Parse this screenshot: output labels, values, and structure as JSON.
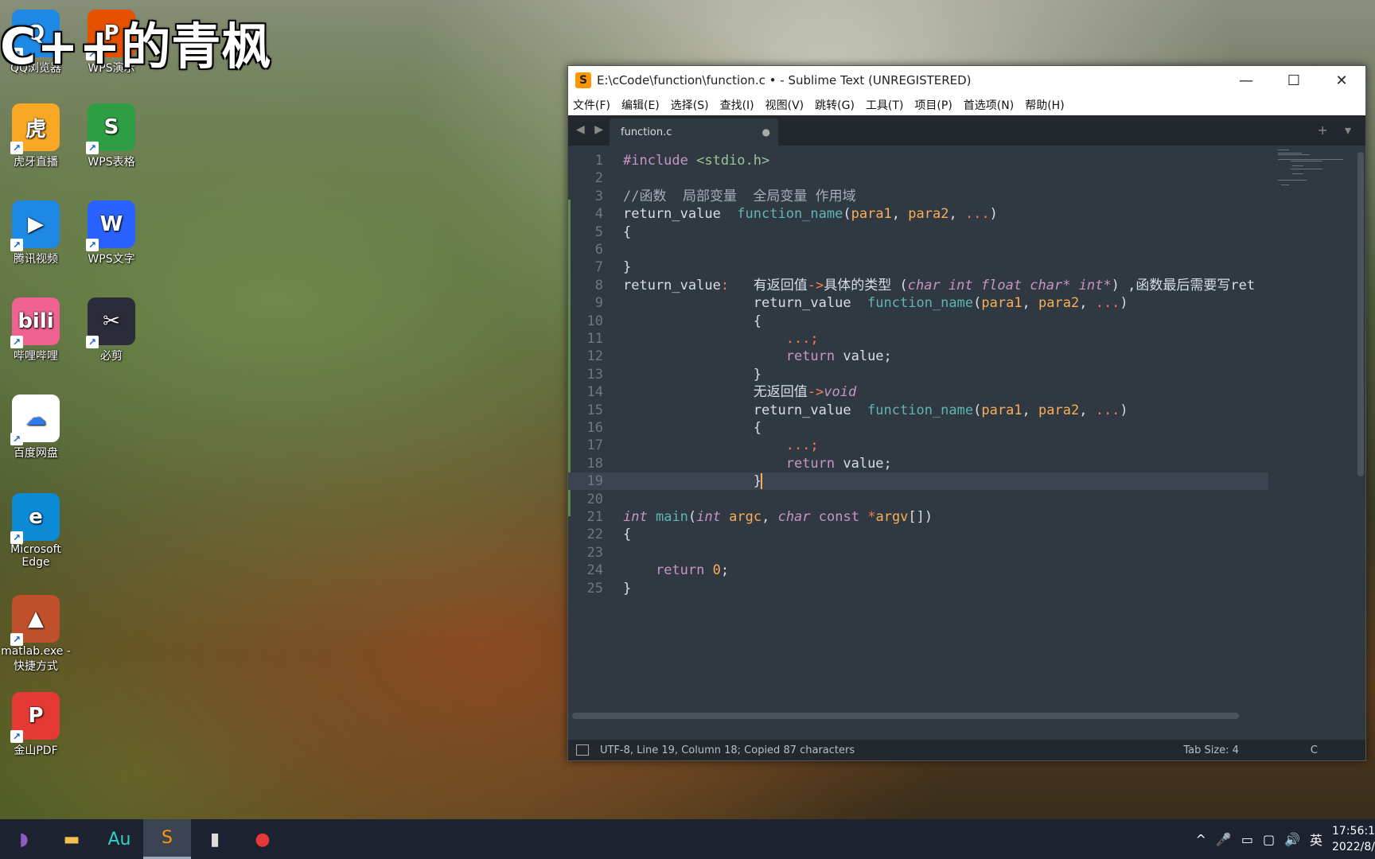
{
  "overlay_title": "C++的青枫",
  "desktop": {
    "icons": [
      {
        "label": "QQ浏览器",
        "icon": "qq-browser-icon",
        "glyph": "Q",
        "color": "#1e88e5"
      },
      {
        "label": "WPS演示",
        "icon": "wps-slides-icon",
        "glyph": "P",
        "color": "#e65100"
      },
      {
        "label": "虎牙直播",
        "icon": "huya-icon",
        "glyph": "虎",
        "color": "#f9a825"
      },
      {
        "label": "WPS表格",
        "icon": "wps-sheets-icon",
        "glyph": "S",
        "color": "#2e9e44"
      },
      {
        "label": "腾讯视频",
        "icon": "tencent-video-icon",
        "glyph": "▶",
        "color": "#1e88e5"
      },
      {
        "label": "WPS文字",
        "icon": "wps-writer-icon",
        "glyph": "W",
        "color": "#2962ff"
      },
      {
        "label": "哔哩哔哩",
        "icon": "bilibili-icon",
        "glyph": "bili",
        "color": "#f06292"
      },
      {
        "label": "必剪",
        "icon": "bijian-icon",
        "glyph": "✂",
        "color": "#2b2b3a"
      },
      {
        "label": "百度网盘",
        "icon": "baidu-pan-icon",
        "glyph": "☁",
        "color": "#ffffff"
      },
      {
        "label": "Microsoft Edge",
        "icon": "edge-icon",
        "glyph": "e",
        "color": "#0b8bd6"
      },
      {
        "label": "matlab.exe - 快捷方式",
        "icon": "matlab-icon",
        "glyph": "▲",
        "color": "#c0502a"
      },
      {
        "label": "金山PDF",
        "icon": "kingsoft-pdf-icon",
        "glyph": "P",
        "color": "#e53935"
      }
    ]
  },
  "window": {
    "title": "E:\\cCode\\function\\function.c • - Sublime Text (UNREGISTERED)",
    "app_glyph": "S",
    "controls": {
      "minimize": "—",
      "maximize": "☐",
      "close": "✕"
    },
    "menu": [
      "文件(F)",
      "编辑(E)",
      "选择(S)",
      "查找(I)",
      "视图(V)",
      "跳转(G)",
      "工具(T)",
      "项目(P)",
      "首选项(N)",
      "帮助(H)"
    ],
    "tab": {
      "name": "function.c",
      "dirty": "●"
    },
    "tab_nav": "◀ ▶",
    "tab_right": "+ ▾"
  },
  "code_lines": [
    {
      "n": "1",
      "tokens": [
        [
          "pre",
          "#include "
        ],
        [
          "str",
          "<stdio.h>"
        ]
      ]
    },
    {
      "n": "2",
      "tokens": []
    },
    {
      "n": "3",
      "tokens": [
        [
          "com",
          "//函数  局部变量  全局变量 作用域"
        ]
      ]
    },
    {
      "n": "4",
      "tokens": [
        [
          "pl",
          "return_value  "
        ],
        [
          "fn",
          "function_name"
        ],
        [
          "pl",
          "("
        ],
        [
          "par",
          "para1"
        ],
        [
          "pl",
          ", "
        ],
        [
          "par",
          "para2"
        ],
        [
          "pl",
          ", "
        ],
        [
          "op",
          "..."
        ],
        [
          "pl",
          ")"
        ]
      ]
    },
    {
      "n": "5",
      "tokens": [
        [
          "pl",
          "{"
        ]
      ]
    },
    {
      "n": "6",
      "tokens": []
    },
    {
      "n": "7",
      "tokens": [
        [
          "pl",
          "}"
        ]
      ]
    },
    {
      "n": "8",
      "tokens": [
        [
          "pl",
          "return_value"
        ],
        [
          "op",
          ":"
        ],
        [
          "pl",
          "   有返回值"
        ],
        [
          "op",
          "->"
        ],
        [
          "pl",
          "具体的类型 ("
        ],
        [
          "kw",
          "char int float char* int*"
        ],
        [
          "pl",
          ") ,函数最后需要写ret"
        ]
      ]
    },
    {
      "n": "9",
      "tokens": [
        [
          "pl",
          "                return_value  "
        ],
        [
          "fn",
          "function_name"
        ],
        [
          "pl",
          "("
        ],
        [
          "par",
          "para1"
        ],
        [
          "pl",
          ", "
        ],
        [
          "par",
          "para2"
        ],
        [
          "pl",
          ", "
        ],
        [
          "op",
          "..."
        ],
        [
          "pl",
          ")"
        ]
      ]
    },
    {
      "n": "10",
      "tokens": [
        [
          "pl",
          "                {"
        ]
      ]
    },
    {
      "n": "11",
      "tokens": [
        [
          "pl",
          "                    "
        ],
        [
          "op",
          "...;"
        ]
      ]
    },
    {
      "n": "12",
      "tokens": [
        [
          "pl",
          "                    "
        ],
        [
          "pre",
          "return"
        ],
        [
          "pl",
          " value;"
        ]
      ]
    },
    {
      "n": "13",
      "tokens": [
        [
          "pl",
          "                }"
        ]
      ]
    },
    {
      "n": "14",
      "tokens": [
        [
          "pl",
          "                无返回值"
        ],
        [
          "op",
          "->"
        ],
        [
          "kw",
          "void"
        ]
      ]
    },
    {
      "n": "15",
      "tokens": [
        [
          "pl",
          "                return_value  "
        ],
        [
          "fn",
          "function_name"
        ],
        [
          "pl",
          "("
        ],
        [
          "par",
          "para1"
        ],
        [
          "pl",
          ", "
        ],
        [
          "par",
          "para2"
        ],
        [
          "pl",
          ", "
        ],
        [
          "op",
          "..."
        ],
        [
          "pl",
          ")"
        ]
      ]
    },
    {
      "n": "16",
      "tokens": [
        [
          "pl",
          "                {"
        ]
      ]
    },
    {
      "n": "17",
      "tokens": [
        [
          "pl",
          "                    "
        ],
        [
          "op",
          "...;"
        ]
      ]
    },
    {
      "n": "18",
      "tokens": [
        [
          "pl",
          "                    "
        ],
        [
          "pre",
          "return"
        ],
        [
          "pl",
          " value;"
        ]
      ]
    },
    {
      "n": "19",
      "tokens": [
        [
          "pl",
          "                }"
        ]
      ],
      "current": true
    },
    {
      "n": "20",
      "tokens": []
    },
    {
      "n": "21",
      "tokens": [
        [
          "kw",
          "int"
        ],
        [
          "pl",
          " "
        ],
        [
          "fn",
          "main"
        ],
        [
          "pl",
          "("
        ],
        [
          "kw",
          "int"
        ],
        [
          "pl",
          " "
        ],
        [
          "par",
          "argc"
        ],
        [
          "pl",
          ", "
        ],
        [
          "kw",
          "char"
        ],
        [
          "pl",
          " "
        ],
        [
          "pre",
          "const"
        ],
        [
          "pl",
          " "
        ],
        [
          "op",
          "*"
        ],
        [
          "par",
          "argv"
        ],
        [
          "pl",
          "[])"
        ]
      ]
    },
    {
      "n": "22",
      "tokens": [
        [
          "pl",
          "{"
        ]
      ]
    },
    {
      "n": "23",
      "tokens": []
    },
    {
      "n": "24",
      "tokens": [
        [
          "pl",
          "    "
        ],
        [
          "pre",
          "return"
        ],
        [
          "pl",
          " "
        ],
        [
          "num",
          "0"
        ],
        [
          "pl",
          ";"
        ]
      ]
    },
    {
      "n": "25",
      "tokens": [
        [
          "pl",
          "}"
        ]
      ]
    }
  ],
  "status": {
    "left": "UTF-8, Line 19, Column 18; Copied 87 characters",
    "tab_size": "Tab Size: 4",
    "syntax": "C"
  },
  "taskbar": {
    "items": [
      {
        "icon": "visual-studio-icon",
        "glyph": "◗",
        "color": "#8e5cc9"
      },
      {
        "icon": "file-explorer-icon",
        "glyph": "▬",
        "color": "#f2c14e"
      },
      {
        "icon": "audition-icon",
        "glyph": "Au",
        "color": "#2fd3c4"
      },
      {
        "icon": "sublime-text-icon",
        "glyph": "S",
        "color": "#ff9800",
        "active": true
      },
      {
        "icon": "terminal-icon",
        "glyph": "▮",
        "color": "#dddddd"
      },
      {
        "icon": "record-icon",
        "glyph": "●",
        "color": "#e53935"
      }
    ],
    "tray": {
      "chevron": "^",
      "mic": "🎤",
      "battery": "▭",
      "network": "▢",
      "volume": "🔊",
      "ime": "英",
      "time": "17:56:1",
      "date": "2022/8/"
    }
  }
}
